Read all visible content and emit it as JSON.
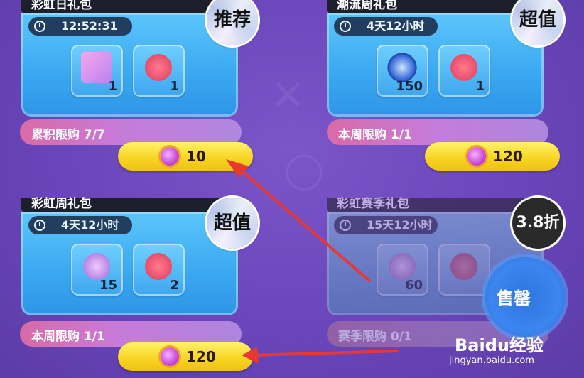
{
  "cards": [
    {
      "title": "彩虹日礼包",
      "timer": "12:52:31",
      "badge": "推荐",
      "items": [
        {
          "icon": "gift-box-icon",
          "qty": "1"
        },
        {
          "icon": "flower-bouquet-icon",
          "qty": "1"
        }
      ],
      "limit": "累积限购 7/7",
      "price": "10"
    },
    {
      "title": "潮流周礼包",
      "timer": "4天12小时",
      "badge": "超值",
      "items": [
        {
          "icon": "blue-token-icon",
          "qty": "150"
        },
        {
          "icon": "flower-bouquet-icon",
          "qty": "1"
        }
      ],
      "limit": "本周限购 1/1",
      "price": "120"
    },
    {
      "title": "彩虹周礼包",
      "timer": "4天12小时",
      "badge": "超值",
      "items": [
        {
          "icon": "crown-coin-icon",
          "qty": "15"
        },
        {
          "icon": "flower-bouquet-icon",
          "qty": "2"
        }
      ],
      "limit": "本周限购 1/1",
      "price": "120"
    },
    {
      "title": "彩虹赛季礼包",
      "timer": "15天12小时",
      "badge": "3.8折",
      "items": [
        {
          "icon": "crown-coin-icon",
          "qty": "60"
        },
        {
          "icon": "flower-bouquet-icon",
          "qty": ""
        }
      ],
      "limit": "赛季限购 0/1",
      "sold_out": "售罄"
    }
  ],
  "watermark": {
    "brand": "Baidu经验",
    "url": "jingyan.baidu.com"
  },
  "colors": {
    "accent": "#f7d320",
    "card": "#3aa7f1",
    "annotation_arrow": "#e53935"
  }
}
